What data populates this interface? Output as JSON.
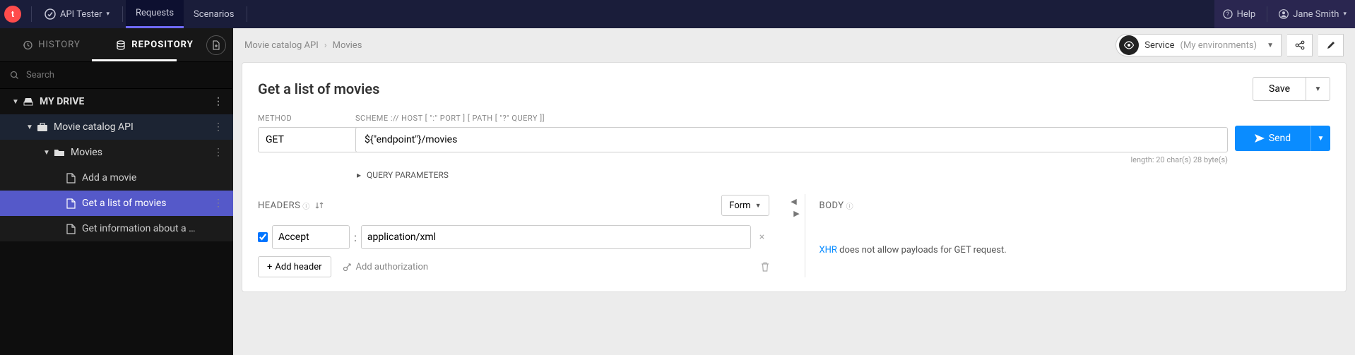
{
  "topbar": {
    "app_menu": "API Tester",
    "tab_requests": "Requests",
    "tab_scenarios": "Scenarios",
    "help": "Help",
    "user_name": "Jane Smith"
  },
  "sidebar": {
    "tab_history": "HISTORY",
    "tab_repository": "REPOSITORY",
    "search_placeholder": "Search",
    "drive_label": "MY DRIVE",
    "project_label": "Movie catalog API",
    "folder_label": "Movies",
    "items": [
      {
        "label": "Add a movie"
      },
      {
        "label": "Get a list of movies"
      },
      {
        "label": "Get information about a …"
      }
    ]
  },
  "breadcrumb": {
    "a": "Movie catalog API",
    "b": "Movies"
  },
  "env": {
    "label": "Service",
    "sub": "(My environments)"
  },
  "request": {
    "title": "Get a list of movies",
    "save": "Save",
    "method_label": "METHOD",
    "method_value": "GET",
    "url_label": "SCHEME :// HOST [ \":\" PORT ] [ PATH [ \"?\" QUERY ]]",
    "url_value": "${\"endpoint\"}/movies",
    "send": "Send",
    "length_info": "length: 20 char(s) 28 byte(s)",
    "query_toggle": "QUERY PARAMETERS"
  },
  "headers": {
    "title": "HEADERS",
    "form_label": "Form",
    "row": {
      "name": "Accept",
      "value": "application/xml"
    },
    "add_header": "Add header",
    "add_auth": "Add authorization"
  },
  "body": {
    "title": "BODY",
    "xhr": "XHR",
    "msg": " does not allow payloads for GET request."
  }
}
